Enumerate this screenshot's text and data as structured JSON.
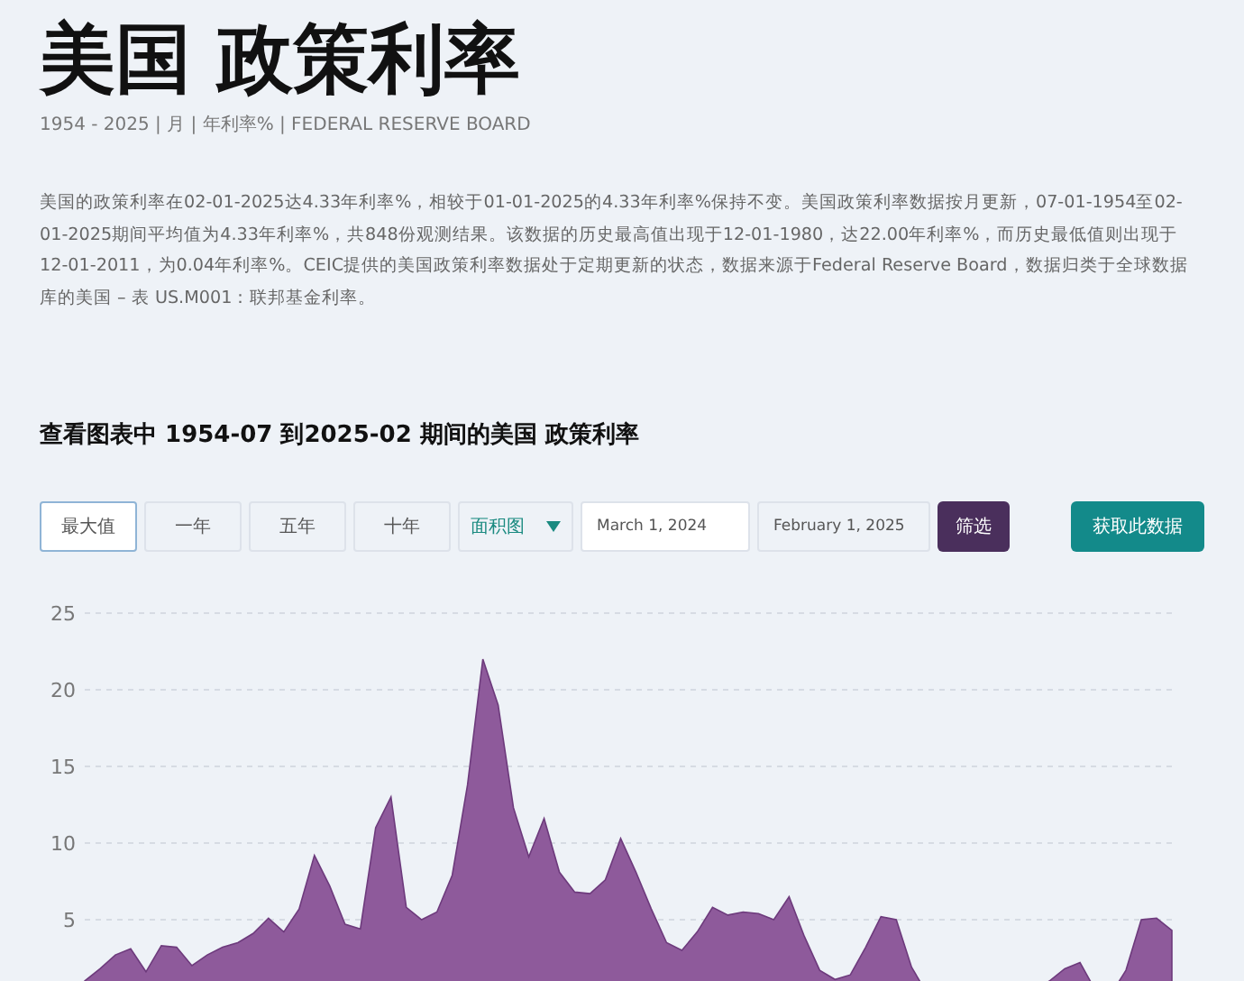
{
  "header": {
    "title": "美国 政策利率",
    "subtitle": "1954 - 2025 | 月 | 年利率% | FEDERAL RESERVE BOARD"
  },
  "description": "美国的政策利率在02-01-2025达4.33年利率%，相较于01-01-2025的4.33年利率%保持不变。美国政策利率数据按月更新，07-01-1954至02-01-2025期间平均值为4.33年利率%，共848份观测结果。该数据的历史最高值出现于12-01-1980，达22.00年利率%，而历史最低值则出现于12-01-2011，为0.04年利率%。CEIC提供的美国政策利率数据处于定期更新的状态，数据来源于Federal Reserve Board，数据归类于全球数据库的美国 – 表 US.M001：联邦基金利率。",
  "chart_heading": "查看图表中 1954-07 到2025-02 期间的美国 政策利率",
  "range_buttons": [
    {
      "label": "最大值",
      "selected": true
    },
    {
      "label": "一年",
      "selected": false
    },
    {
      "label": "五年",
      "selected": false
    },
    {
      "label": "十年",
      "selected": false
    }
  ],
  "chart_type_select": {
    "value": "面积图"
  },
  "start_date": {
    "value": "March 1, 2024"
  },
  "end_date": {
    "value": "February 1, 2025"
  },
  "filter_button": "筛选",
  "get_data_button": "获取此数据",
  "chart_data": {
    "type": "area",
    "grid": true,
    "ylim": [
      0,
      25
    ],
    "yticks": [
      5,
      10,
      15,
      20,
      25
    ],
    "series": [
      {
        "color": "#8e5a9b",
        "values": [
          1.0,
          1.8,
          2.7,
          3.1,
          1.6,
          3.3,
          3.2,
          2.0,
          2.7,
          3.2,
          3.5,
          4.1,
          5.1,
          4.2,
          5.7,
          9.2,
          7.2,
          4.7,
          4.4,
          11.0,
          13.0,
          5.8,
          5.0,
          5.5,
          7.9,
          13.8,
          22.0,
          19.0,
          12.3,
          9.1,
          11.6,
          8.1,
          6.8,
          6.7,
          7.6,
          10.3,
          8.1,
          5.7,
          3.5,
          3.0,
          4.2,
          5.8,
          5.3,
          5.5,
          5.4,
          5.0,
          6.5,
          3.9,
          1.7,
          1.1,
          1.4,
          3.2,
          5.2,
          5.0,
          1.9,
          0.2,
          0.2,
          0.1,
          0.1,
          0.1,
          0.1,
          0.1,
          0.4,
          1.0,
          1.8,
          2.2,
          0.4,
          0.1,
          1.7,
          5.0,
          5.1,
          4.3
        ]
      }
    ]
  }
}
